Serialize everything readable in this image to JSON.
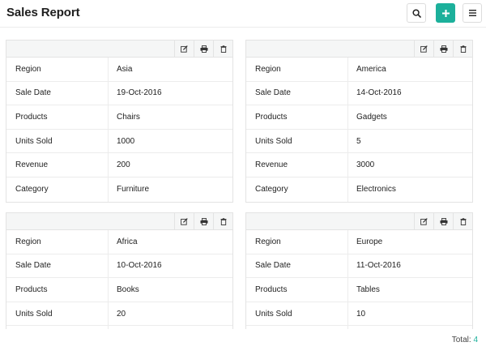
{
  "header": {
    "title": "Sales Report",
    "search_icon": "search-icon",
    "add_icon": "plus-icon",
    "menu_icon": "hamburger-menu-icon",
    "accent_color": "#1cb09b"
  },
  "labels": {
    "region": "Region",
    "sale_date": "Sale Date",
    "products": "Products",
    "units_sold": "Units Sold",
    "revenue": "Revenue",
    "category": "Category"
  },
  "card_actions": {
    "edit_icon": "edit-icon",
    "print_icon": "print-icon",
    "delete_icon": "trash-icon"
  },
  "records": [
    {
      "region": "Asia",
      "sale_date": "19-Oct-2016",
      "products": "Chairs",
      "units_sold": "1000",
      "revenue": "200",
      "category": "Furniture"
    },
    {
      "region": "America",
      "sale_date": "14-Oct-2016",
      "products": "Gadgets",
      "units_sold": "5",
      "revenue": "3000",
      "category": "Electronics"
    },
    {
      "region": "Africa",
      "sale_date": "10-Oct-2016",
      "products": "Books",
      "units_sold": "20"
    },
    {
      "region": "Europe",
      "sale_date": "11-Oct-2016",
      "products": "Tables",
      "units_sold": "10"
    }
  ],
  "footer": {
    "total_label": "Total:",
    "total_count": "4"
  }
}
